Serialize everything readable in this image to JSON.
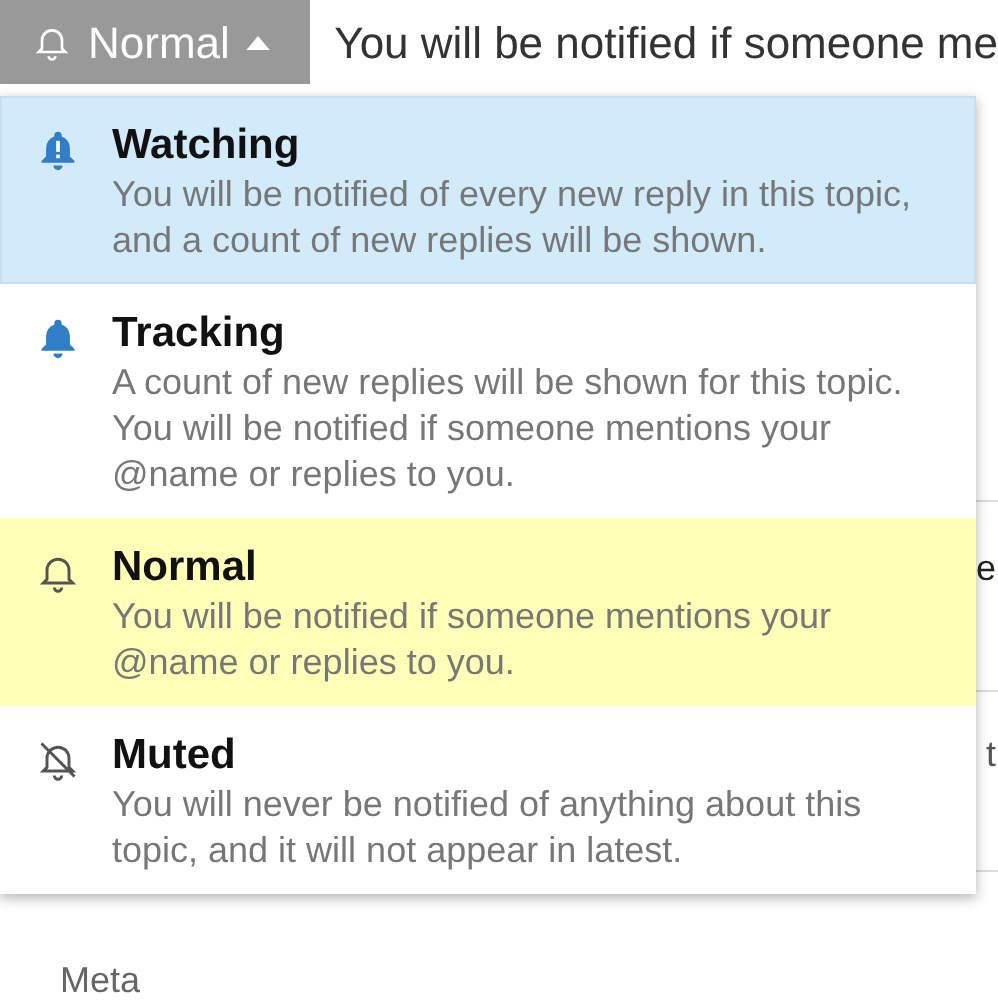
{
  "notification_button": {
    "label": "Normal"
  },
  "current_description": "You will be notified if someone me",
  "menu": [
    {
      "kind": "watching",
      "title": "Watching",
      "description": "You will be notified of every new reply in this topic, and a count of new replies will be shown.",
      "selected": false,
      "highlighted": true
    },
    {
      "kind": "tracking",
      "title": "Tracking",
      "description": "A count of new replies will be shown for this topic. You will be notified if someone mentions your @name or replies to you.",
      "selected": false,
      "highlighted": false
    },
    {
      "kind": "normal",
      "title": "Normal",
      "description": "You will be notified if someone mentions your @name or replies to you.",
      "selected": true,
      "highlighted": false
    },
    {
      "kind": "muted",
      "title": "Muted",
      "description": "You will never be notified of anything about this topic, and it will not appear in latest.",
      "selected": false,
      "highlighted": false
    }
  ],
  "background_fragments": [
    "e",
    "t"
  ],
  "background_heading": "Meta"
}
